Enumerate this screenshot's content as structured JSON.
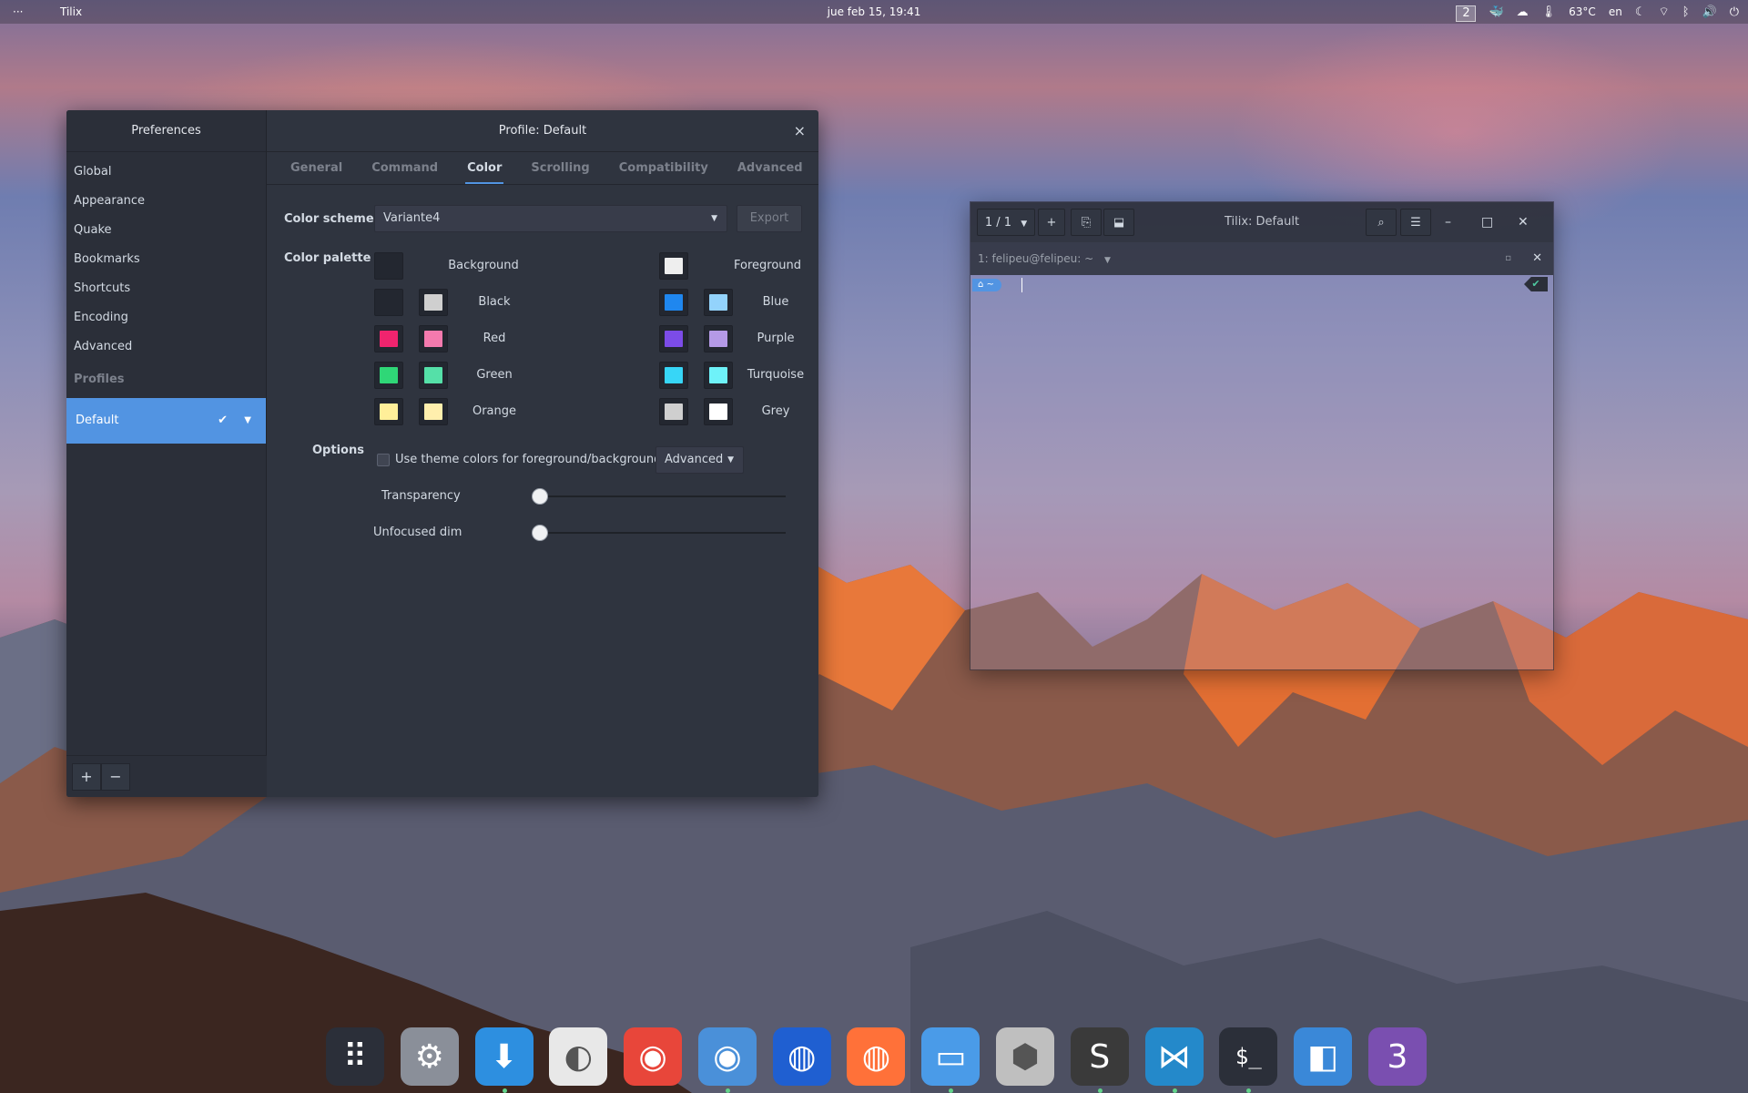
{
  "topbar": {
    "menu_dots": "···",
    "app_name": "Tilix",
    "datetime": "jue feb 15, 19:41",
    "workspace": "2",
    "temperature": "63°C",
    "lang": "en"
  },
  "preferences": {
    "title": "Preferences",
    "items": [
      {
        "label": "Global"
      },
      {
        "label": "Appearance"
      },
      {
        "label": "Quake"
      },
      {
        "label": "Bookmarks"
      },
      {
        "label": "Shortcuts"
      },
      {
        "label": "Encoding"
      },
      {
        "label": "Advanced"
      }
    ],
    "profiles_header": "Profiles",
    "profile_selected": "Default",
    "add_label": "+",
    "remove_label": "−"
  },
  "profile": {
    "title": "Profile: Default",
    "close": "×",
    "tabs": [
      {
        "label": "General"
      },
      {
        "label": "Command"
      },
      {
        "label": "Color"
      },
      {
        "label": "Scrolling"
      },
      {
        "label": "Compatibility"
      },
      {
        "label": "Advanced"
      }
    ],
    "active_tab": "Color",
    "color_scheme_label": "Color scheme",
    "color_scheme_value": "Variante4",
    "export_label": "Export",
    "palette_label": "Color palette",
    "palette": {
      "background": {
        "label": "Background",
        "color": "#232730"
      },
      "foreground": {
        "label": "Foreground",
        "color": "#eeeeee"
      },
      "left": [
        {
          "label": "Black",
          "normal": "#232730",
          "bright": "#cfcfcf"
        },
        {
          "label": "Red",
          "normal": "#f0246e",
          "bright": "#f47aae"
        },
        {
          "label": "Green",
          "normal": "#2fd777",
          "bright": "#55e0a8"
        },
        {
          "label": "Orange",
          "normal": "#ffef99",
          "bright": "#ffefad"
        }
      ],
      "right": [
        {
          "label": "Blue",
          "normal": "#1f87ef",
          "bright": "#93d3fc"
        },
        {
          "label": "Purple",
          "normal": "#7c4ce8",
          "bright": "#b59ae7"
        },
        {
          "label": "Turquoise",
          "normal": "#37d6f7",
          "bright": "#6ef2f9"
        },
        {
          "label": "Grey",
          "normal": "#cfcfcf",
          "bright": "#ffffff"
        }
      ]
    },
    "options_label": "Options",
    "theme_colors_label": "Use theme colors for foreground/background",
    "advanced_combo": "Advanced",
    "transparency_label": "Transparency",
    "transparency_value": 0,
    "unfocused_dim_label": "Unfocused dim",
    "unfocused_dim_value": 0
  },
  "terminal": {
    "session_counter": "1 / 1",
    "title": "Tilix: Default",
    "tab_title": "1: felipeu@felipeu: ~",
    "prompt": "~"
  },
  "dock": [
    {
      "name": "app-grid",
      "color": "#2b2f39",
      "running": false
    },
    {
      "name": "settings",
      "color": "#8a8f99",
      "running": false
    },
    {
      "name": "downloader",
      "color": "#2d8fe0",
      "running": true
    },
    {
      "name": "tweaks",
      "color": "#e8e8e8",
      "running": false
    },
    {
      "name": "chrome",
      "color": "#e8463a",
      "running": false
    },
    {
      "name": "chromium",
      "color": "#4a90d9",
      "running": true
    },
    {
      "name": "firefox-dev",
      "color": "#1f5fd1",
      "running": false
    },
    {
      "name": "firefox",
      "color": "#ff7139",
      "running": false
    },
    {
      "name": "files",
      "color": "#4a9be8",
      "running": true
    },
    {
      "name": "dock-app",
      "color": "#bfbfbf",
      "running": false
    },
    {
      "name": "sublime",
      "color": "#3a3a3a",
      "running": true
    },
    {
      "name": "vscode",
      "color": "#2489ca",
      "running": true
    },
    {
      "name": "terminal",
      "color": "#2b2f39",
      "running": true
    },
    {
      "name": "boxes",
      "color": "#3a88d8",
      "running": false
    },
    {
      "name": "app-3",
      "color": "#7a4fb0",
      "running": false
    }
  ]
}
